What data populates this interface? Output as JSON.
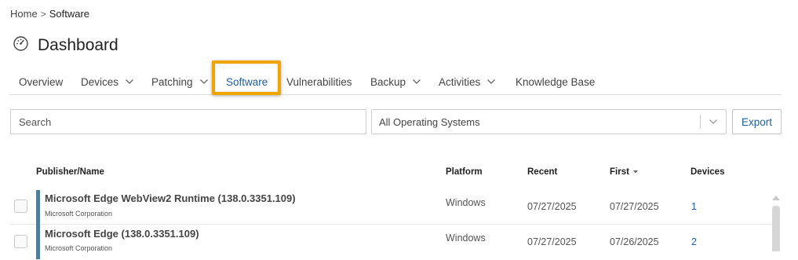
{
  "breadcrumb": {
    "home": "Home",
    "separator": ">",
    "current": "Software"
  },
  "header": {
    "title": "Dashboard",
    "icon": "dashboard-gauge-icon"
  },
  "tabs": [
    {
      "label": "Overview",
      "dropdown": false
    },
    {
      "label": "Devices",
      "dropdown": true
    },
    {
      "label": "Patching",
      "dropdown": true
    },
    {
      "label": "Software",
      "dropdown": false,
      "active": true
    },
    {
      "label": "Vulnerabilities",
      "dropdown": false
    },
    {
      "label": "Backup",
      "dropdown": true
    },
    {
      "label": "Activities",
      "dropdown": true
    },
    {
      "label": "Knowledge Base",
      "dropdown": false
    }
  ],
  "filters": {
    "search_placeholder": "Search",
    "os_select_value": "All Operating Systems",
    "export_label": "Export"
  },
  "table": {
    "columns": {
      "name": "Publisher/Name",
      "platform": "Platform",
      "recent": "Recent",
      "first": "First",
      "devices": "Devices"
    },
    "sort_column": "First",
    "rows": [
      {
        "name": "Microsoft Edge WebView2 Runtime (138.0.3351.109)",
        "publisher": "Microsoft Corporation",
        "platform": "Windows",
        "recent": "07/27/2025",
        "first": "07/27/2025",
        "devices": "1"
      },
      {
        "name": "Microsoft Edge (138.0.3351.109)",
        "publisher": "Microsoft Corporation",
        "platform": "Windows",
        "recent": "07/27/2025",
        "first": "07/26/2025",
        "devices": "2"
      }
    ]
  },
  "colors": {
    "accent": "#1e5fa0",
    "highlight": "#f0a500",
    "row_marker": "#4d7f9a"
  }
}
